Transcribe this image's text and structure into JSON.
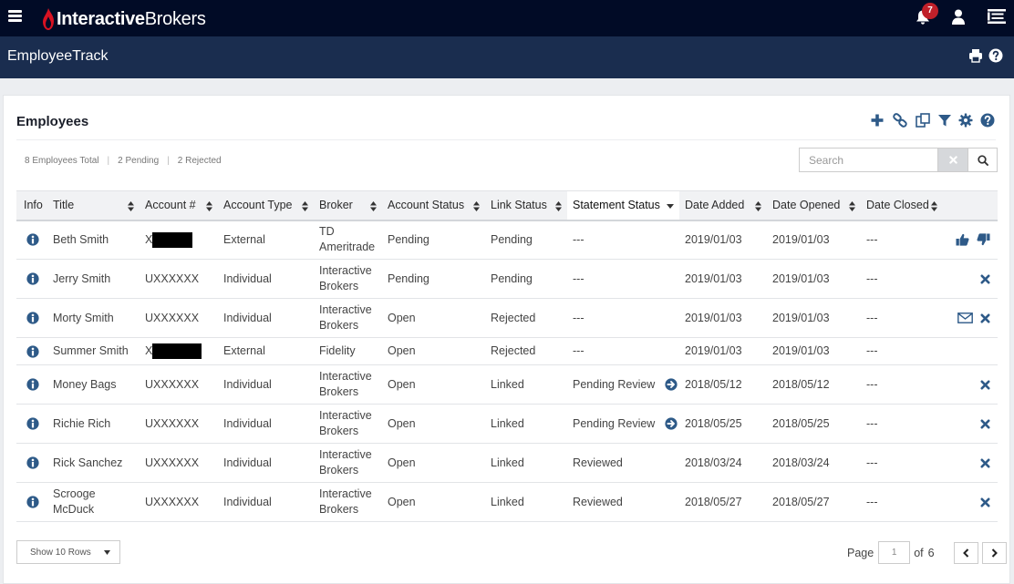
{
  "topbar": {
    "brand_bold": "Interactive",
    "brand_light": "Brokers",
    "notification_count": "7",
    "colors": {
      "bar": "#010b26",
      "brand_red": "#d81222",
      "badge": "#c0202a"
    }
  },
  "subbar": {
    "app_title": "EmployeeTrack"
  },
  "panel": {
    "title": "Employees",
    "toolbar_icons": [
      "plus-icon",
      "link-icon",
      "copy-icon",
      "filter-icon",
      "gear-icon",
      "help-icon"
    ],
    "summary": {
      "total": "8 Employees Total",
      "pending": "2 Pending",
      "rejected": "2 Rejected"
    },
    "search": {
      "placeholder": "Search",
      "value": ""
    }
  },
  "table": {
    "columns": [
      "Info",
      "Title",
      "Account #",
      "Account Type",
      "Broker",
      "Account Status",
      "Link Status",
      "Statement Status",
      "Date Added",
      "Date Opened",
      "Date Closed"
    ],
    "sorted_column": "Statement Status",
    "rows": [
      {
        "title": "Beth Smith",
        "account": "X",
        "account_redacted": true,
        "type": "External",
        "broker": "TD Ameritrade",
        "account_status": "Pending",
        "link_status": "Pending",
        "statement_status": "---",
        "statement_link": false,
        "date_added": "2019/01/03",
        "date_opened": "2019/01/03",
        "date_closed": "---",
        "actions": [
          "thumbs-up-icon",
          "thumbs-down-icon"
        ]
      },
      {
        "title": "Jerry Smith",
        "account": "UXXXXXX",
        "account_redacted": false,
        "type": "Individual",
        "broker": "Interactive Brokers",
        "account_status": "Pending",
        "link_status": "Pending",
        "statement_status": "---",
        "statement_link": false,
        "date_added": "2019/01/03",
        "date_opened": "2019/01/03",
        "date_closed": "---",
        "actions": [
          "close-icon"
        ]
      },
      {
        "title": "Morty Smith",
        "account": "UXXXXXX",
        "account_redacted": false,
        "type": "Individual",
        "broker": "Interactive Brokers",
        "account_status": "Open",
        "link_status": "Rejected",
        "statement_status": "---",
        "statement_link": false,
        "date_added": "2019/01/03",
        "date_opened": "2019/01/03",
        "date_closed": "---",
        "actions": [
          "envelope-icon",
          "close-icon"
        ]
      },
      {
        "title": "Summer Smith",
        "account": "X",
        "account_redacted": true,
        "type": "External",
        "broker": "Fidelity",
        "account_status": "Open",
        "link_status": "Rejected",
        "statement_status": "---",
        "statement_link": false,
        "date_added": "2019/01/03",
        "date_opened": "2019/01/03",
        "date_closed": "---",
        "actions": []
      },
      {
        "title": "Money Bags",
        "account": "UXXXXXX",
        "account_redacted": false,
        "type": "Individual",
        "broker": "Interactive Brokers",
        "account_status": "Open",
        "link_status": "Linked",
        "statement_status": "Pending Review",
        "statement_link": true,
        "date_added": "2018/05/12",
        "date_opened": "2018/05/12",
        "date_closed": "---",
        "actions": [
          "close-icon"
        ]
      },
      {
        "title": "Richie Rich",
        "account": "UXXXXXX",
        "account_redacted": false,
        "type": "Individual",
        "broker": "Interactive Brokers",
        "account_status": "Open",
        "link_status": "Linked",
        "statement_status": "Pending Review",
        "statement_link": true,
        "date_added": "2018/05/25",
        "date_opened": "2018/05/25",
        "date_closed": "---",
        "actions": [
          "close-icon"
        ]
      },
      {
        "title": "Rick Sanchez",
        "account": "UXXXXXX",
        "account_redacted": false,
        "type": "Individual",
        "broker": "Interactive Brokers",
        "account_status": "Open",
        "link_status": "Linked",
        "statement_status": "Reviewed",
        "statement_link": false,
        "date_added": "2018/03/24",
        "date_opened": "2018/03/24",
        "date_closed": "---",
        "actions": [
          "close-icon"
        ]
      },
      {
        "title": "Scrooge McDuck",
        "account": "UXXXXXX",
        "account_redacted": false,
        "type": "Individual",
        "broker": "Interactive Brokers",
        "account_status": "Open",
        "link_status": "Linked",
        "statement_status": "Reviewed",
        "statement_link": false,
        "date_added": "2018/05/27",
        "date_opened": "2018/05/27",
        "date_closed": "---",
        "actions": [
          "close-icon"
        ]
      }
    ]
  },
  "footer": {
    "rows_select": "Show 10 Rows",
    "page_label": "Page",
    "page_value": "1",
    "of_label": "of",
    "total_pages": "6"
  },
  "colors": {
    "accent": "#2e5a88",
    "table_header": "#f1f2f4",
    "subbar": "#1a2d4f"
  }
}
